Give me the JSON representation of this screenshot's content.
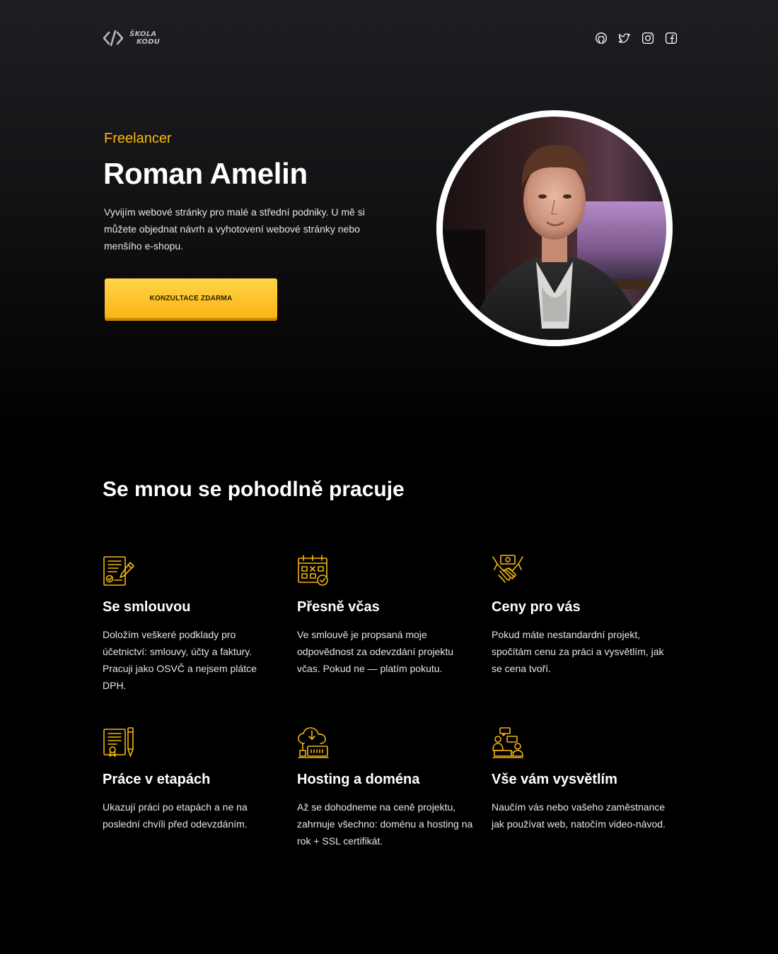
{
  "header": {
    "logo": {
      "line1": "ŠKOLA",
      "line2": "KÓDU"
    },
    "socials": [
      {
        "icon": "github-icon"
      },
      {
        "icon": "twitter-icon"
      },
      {
        "icon": "instagram-icon"
      },
      {
        "icon": "facebook-icon"
      }
    ]
  },
  "hero": {
    "eyebrow": "Freelancer",
    "name": "Roman Amelin",
    "intro": "Vyvijím webové stránky pro malé a střední podniky. U mě si můžete objednat návrh a vyhotovení webové stránky nebo menšího e-shopu.",
    "cta_label": "KONZULTACE ZDARMA"
  },
  "features": {
    "title": "Se mnou se pohodlně pracuje",
    "items": [
      {
        "icon": "contract-icon",
        "title": "Se smlouvou",
        "text": "Doložím veškeré podklady pro účetnictví: smlouvy, účty a faktury. Pracuji jako OSVČ a nejsem plátce DPH."
      },
      {
        "icon": "calendar-icon",
        "title": "Přesně včas",
        "text": "Ve smlouvě je propsaná moje odpovědnost za odevzdání projektu včas. Pokud ne — platím pokutu."
      },
      {
        "icon": "handshake-icon",
        "title": "Ceny pro vás",
        "text": "Pokud máte nestandardní projekt, spočítám cenu za práci a vysvětlím, jak se cena tvoří."
      },
      {
        "icon": "certificate-icon",
        "title": "Práce v etapách",
        "text": "Ukazují práci po etapách a ne na poslední chvíli před odevzdáním."
      },
      {
        "icon": "cloud-server-icon",
        "title": "Hosting a doména",
        "text": "Až se dohodneme na ceně projektu, zahrnuje všechno: doménu a hosting na rok + SSL certifikát."
      },
      {
        "icon": "consultation-icon",
        "title": "Vše vám vysvětlím",
        "text": "Naučím vás nebo vašeho zaměstnance jak používat web, natočím video-návod."
      }
    ]
  },
  "colors": {
    "accent": "#F5B60F",
    "background": "#000000",
    "hero_top": "#1F1F23"
  }
}
